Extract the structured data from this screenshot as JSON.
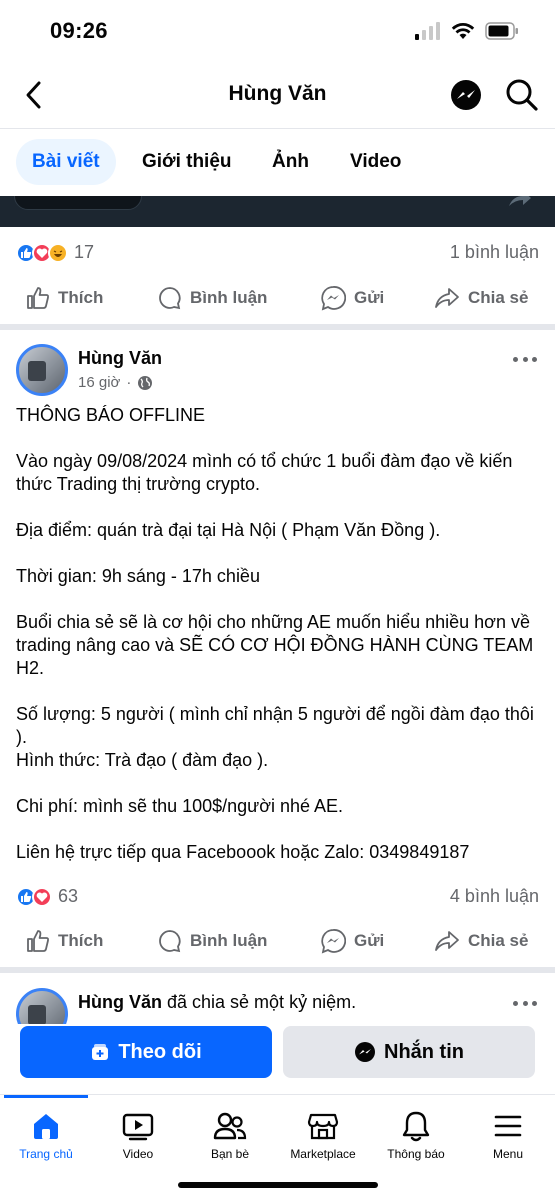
{
  "status": {
    "time": "09:26"
  },
  "header": {
    "title": "Hùng Văn"
  },
  "tabs": [
    {
      "label": "Bài viết",
      "active": true
    },
    {
      "label": "Giới thiệu",
      "active": false
    },
    {
      "label": "Ảnh",
      "active": false
    },
    {
      "label": "Video",
      "active": false
    }
  ],
  "prev_post": {
    "reaction_count": "17",
    "comments": "1 bình luận"
  },
  "actions": {
    "like": "Thích",
    "comment": "Bình luận",
    "send": "Gửi",
    "share": "Chia sẻ"
  },
  "post": {
    "author": "Hùng Văn",
    "time": "16 giờ",
    "lines": [
      "THÔNG BÁO OFFLINE",
      "",
      "Vào ngày 09/08/2024 mình có tổ chức 1 buổi đàm đạo về kiến thức Trading thị trường crypto.",
      "",
      "Địa điểm: quán trà đại tại Hà Nội ( Phạm Văn Đồng ).",
      "",
      "Thời gian: 9h sáng - 17h chiều",
      "",
      "Buổi chia sẻ sẽ là cơ hội cho những AE muốn hiểu nhiều hơn về trading nâng cao và SẼ CÓ CƠ HỘI ĐỒNG HÀNH CÙNG TEAM H2.",
      "",
      "Số lượng: 5 người ( mình chỉ nhận 5 người để ngồi đàm đạo thôi ).",
      "Hình thức: Trà đạo ( đàm đạo ).",
      "",
      "Chi phí: mình sẽ thu 100$/người nhé AE.",
      "",
      "Liên hệ trực tiếp qua Faceboook hoặc Zalo: 0349849187"
    ],
    "reaction_count": "63",
    "comments": "4 bình luận"
  },
  "next_post": {
    "author": "Hùng Văn",
    "action_text": " đã chia sẻ một kỷ niệm."
  },
  "buttons": {
    "follow": "Theo dõi",
    "message": "Nhắn tin"
  },
  "bottom_nav": [
    {
      "label": "Trang chủ",
      "icon": "home-icon",
      "active": true
    },
    {
      "label": "Video",
      "icon": "video-icon",
      "active": false
    },
    {
      "label": "Bạn bè",
      "icon": "friends-icon",
      "active": false
    },
    {
      "label": "Marketplace",
      "icon": "marketplace-icon",
      "active": false
    },
    {
      "label": "Thông báo",
      "icon": "bell-icon",
      "active": false
    },
    {
      "label": "Menu",
      "icon": "menu-icon",
      "active": false
    }
  ],
  "colors": {
    "accent": "#0866ff",
    "secondary_text": "#65676b",
    "divider": "#e4e6eb"
  }
}
